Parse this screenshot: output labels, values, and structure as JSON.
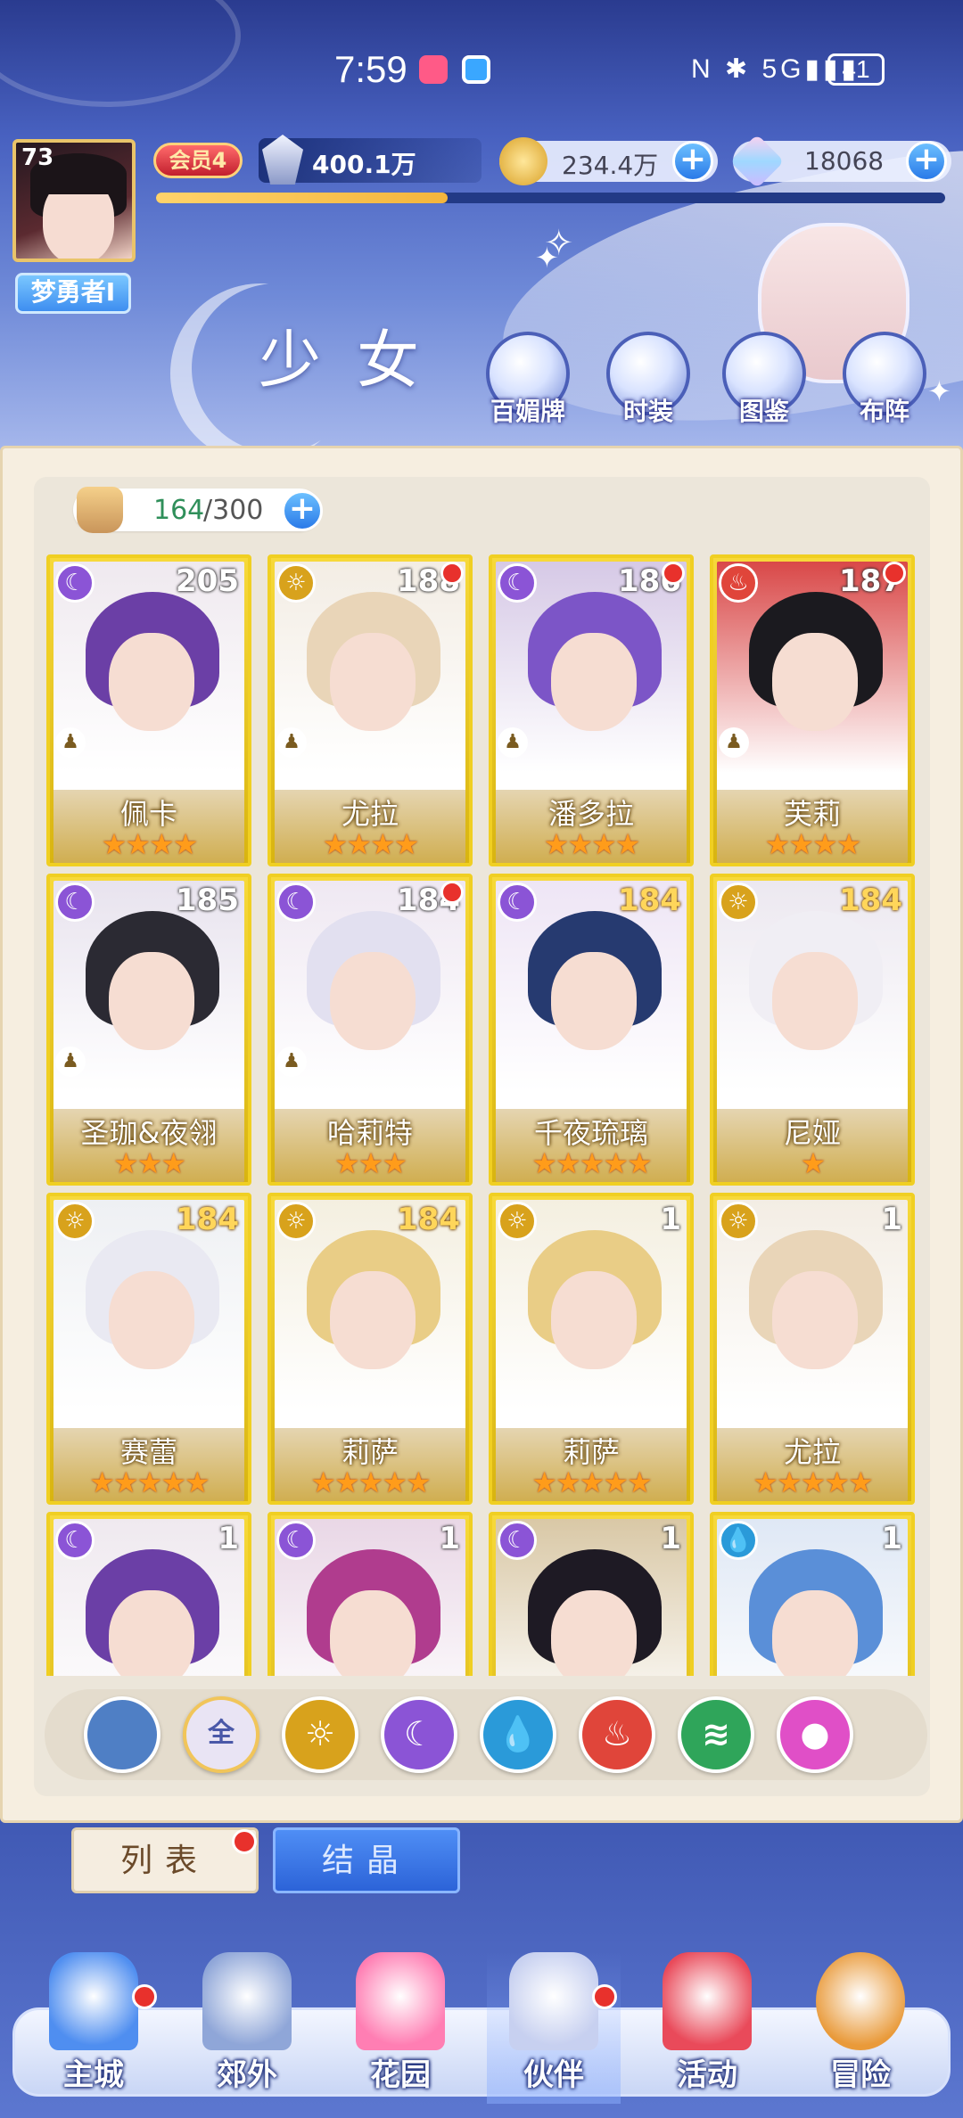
{
  "status_bar": {
    "time": "7:59",
    "network": "5G",
    "battery": "41"
  },
  "player": {
    "level": "73",
    "nickname": "梦勇者I",
    "vip": "会员4",
    "power": "400.1万",
    "exp_progress": 0.37
  },
  "currencies": {
    "gold": "234.4万",
    "gems": "18068"
  },
  "page_title": "少女",
  "top_buttons": [
    {
      "label": "百媚牌",
      "icon": "star-card-icon"
    },
    {
      "label": "时装",
      "icon": "outfit-icon"
    },
    {
      "label": "图鉴",
      "icon": "book-icon"
    },
    {
      "label": "布阵",
      "icon": "formation-icon"
    }
  ],
  "capacity": {
    "current": "164",
    "max": "/300"
  },
  "cards": [
    {
      "name": "佩卡",
      "level": "205",
      "element": "moon",
      "stars": "★★★★",
      "dot": false,
      "role": true,
      "gold_level": false,
      "hair": "#6b3fa6",
      "bg": "#efe9ef"
    },
    {
      "name": "尤拉",
      "level": "188",
      "element": "sun",
      "stars": "★★★★",
      "dot": true,
      "role": true,
      "gold_level": false,
      "hair": "#e9d5b8",
      "bg": "#f3ede4"
    },
    {
      "name": "潘多拉",
      "level": "186",
      "element": "moon",
      "stars": "★★★★",
      "dot": true,
      "role": true,
      "gold_level": false,
      "hair": "#7c55c7",
      "bg": "#d6c9e6"
    },
    {
      "name": "芙莉",
      "level": "187",
      "element": "fire",
      "stars": "★★★★",
      "dot": true,
      "role": true,
      "gold_level": false,
      "hair": "#1b1a1f",
      "bg": "#d94848"
    },
    {
      "name": "圣珈&夜翎",
      "level": "185",
      "element": "moon",
      "stars": "★★★",
      "dot": false,
      "role": true,
      "gold_level": false,
      "hair": "#2b2a33",
      "bg": "#e8e3ee"
    },
    {
      "name": "哈莉特",
      "level": "184",
      "element": "moon",
      "stars": "★★★",
      "dot": true,
      "role": true,
      "gold_level": false,
      "hair": "#e2e0f0",
      "bg": "#efe8f2"
    },
    {
      "name": "千夜琉璃",
      "level": "184",
      "element": "moon",
      "stars": "★★★★★",
      "dot": false,
      "role": false,
      "gold_level": true,
      "hair": "#263a70",
      "bg": "#eee5f5"
    },
    {
      "name": "尼娅",
      "level": "184",
      "element": "sun",
      "stars": "★",
      "dot": false,
      "role": false,
      "gold_level": true,
      "hair": "#f0eef4",
      "bg": "#ece8f0"
    },
    {
      "name": "赛蕾",
      "level": "184",
      "element": "sun",
      "stars": "★★★★★",
      "dot": false,
      "role": false,
      "gold_level": true,
      "hair": "#e9e9f2",
      "bg": "#eef0f3"
    },
    {
      "name": "莉萨",
      "level": "184",
      "element": "sun",
      "stars": "★★★★★",
      "dot": false,
      "role": false,
      "gold_level": true,
      "hair": "#e9cd86",
      "bg": "#f4efe0"
    },
    {
      "name": "莉萨",
      "level": "1",
      "element": "sun",
      "stars": "★★★★★",
      "dot": false,
      "role": false,
      "gold_level": false,
      "hair": "#e9cd86",
      "bg": "#f4efe0"
    },
    {
      "name": "尤拉",
      "level": "1",
      "element": "sun",
      "stars": "★★★★★",
      "dot": false,
      "role": false,
      "gold_level": false,
      "hair": "#e9d5b8",
      "bg": "#f3ede4"
    },
    {
      "name": "",
      "level": "1",
      "element": "moon",
      "stars": "",
      "dot": false,
      "role": false,
      "gold_level": false,
      "hair": "#6b3fa6",
      "bg": "#efe9ef"
    },
    {
      "name": "",
      "level": "1",
      "element": "moon",
      "stars": "",
      "dot": false,
      "role": false,
      "gold_level": false,
      "hair": "#b03c8e",
      "bg": "#e9d7e6"
    },
    {
      "name": "",
      "level": "1",
      "element": "moon",
      "stars": "",
      "dot": false,
      "role": false,
      "gold_level": false,
      "hair": "#1e1a24",
      "bg": "#d9c8a6"
    },
    {
      "name": "",
      "level": "1",
      "element": "water",
      "stars": "",
      "dot": false,
      "role": false,
      "gold_level": false,
      "hair": "#5a8fd8",
      "bg": "#dfe8f5"
    }
  ],
  "element_colors": {
    "moon": "#8b54d6",
    "sun": "#d8a21c",
    "fire": "#e0453a",
    "water": "#2a9ad9"
  },
  "element_glyphs": {
    "moon": "☾",
    "sun": "☼",
    "fire": "♨",
    "water": "💧"
  },
  "filters": [
    {
      "label": "",
      "icon": "collapse-icon",
      "color": "#4f7fc5"
    },
    {
      "label": "全",
      "icon": "all-icon",
      "color": "#e9e4f4"
    },
    {
      "label": "☼",
      "icon": "sun-element-icon",
      "color": "#d8a21c"
    },
    {
      "label": "☾",
      "icon": "moon-element-icon",
      "color": "#8b54d6"
    },
    {
      "label": "💧",
      "icon": "water-element-icon",
      "color": "#2a9ad9"
    },
    {
      "label": "♨",
      "icon": "fire-element-icon",
      "color": "#e0453a"
    },
    {
      "label": "≋",
      "icon": "wind-element-icon",
      "color": "#2fa55a"
    },
    {
      "label": "●",
      "icon": "pink-element-icon",
      "color": "#e04fc7"
    }
  ],
  "tabs": {
    "list": "列表",
    "crystal": "结晶"
  },
  "nav": [
    {
      "label": "主城",
      "icon": "castle-icon",
      "dot": true
    },
    {
      "label": "郊外",
      "icon": "portal-icon",
      "dot": false
    },
    {
      "label": "花园",
      "icon": "heart-icon",
      "dot": false
    },
    {
      "label": "伙伴",
      "icon": "partner-icon",
      "dot": true
    },
    {
      "label": "活动",
      "icon": "gift-icon",
      "dot": false
    },
    {
      "label": "冒险",
      "icon": "compass-icon",
      "dot": false
    }
  ]
}
